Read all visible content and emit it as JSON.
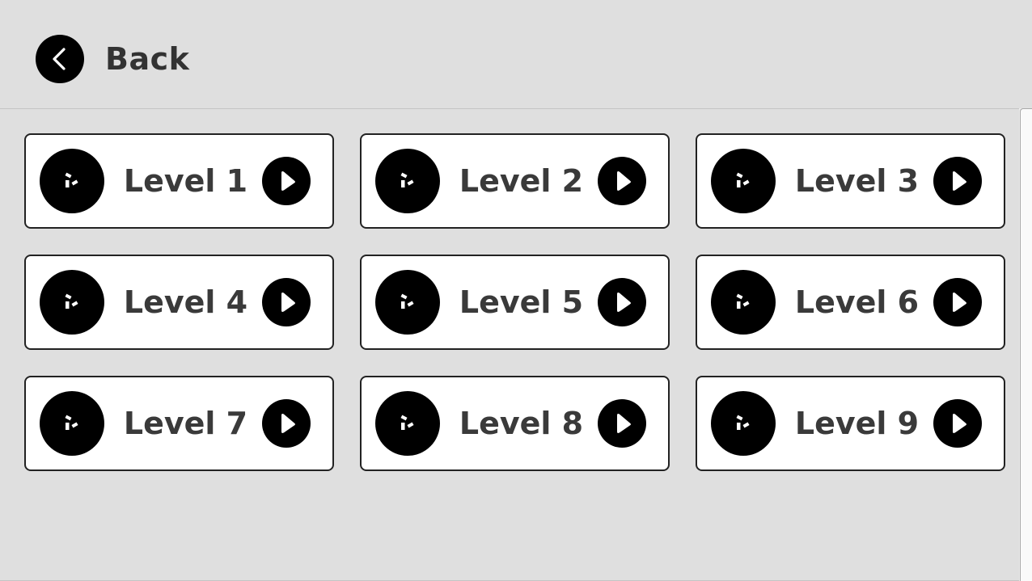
{
  "header": {
    "back_label": "Back",
    "back_icon": "chevron-left-icon"
  },
  "levels": [
    {
      "label": "Level 1"
    },
    {
      "label": "Level 2"
    },
    {
      "label": "Level 3"
    },
    {
      "label": "Level 4"
    },
    {
      "label": "Level 5"
    },
    {
      "label": "Level 6"
    },
    {
      "label": "Level 7"
    },
    {
      "label": "Level 8"
    },
    {
      "label": "Level 9"
    }
  ],
  "icons": {
    "level_icon": "cube-logo-icon",
    "play_icon": "play-icon"
  },
  "colors": {
    "background": "#dfdfdf",
    "card": "#ffffff",
    "icon_fill": "#000000",
    "text": "#3a3a3a"
  }
}
